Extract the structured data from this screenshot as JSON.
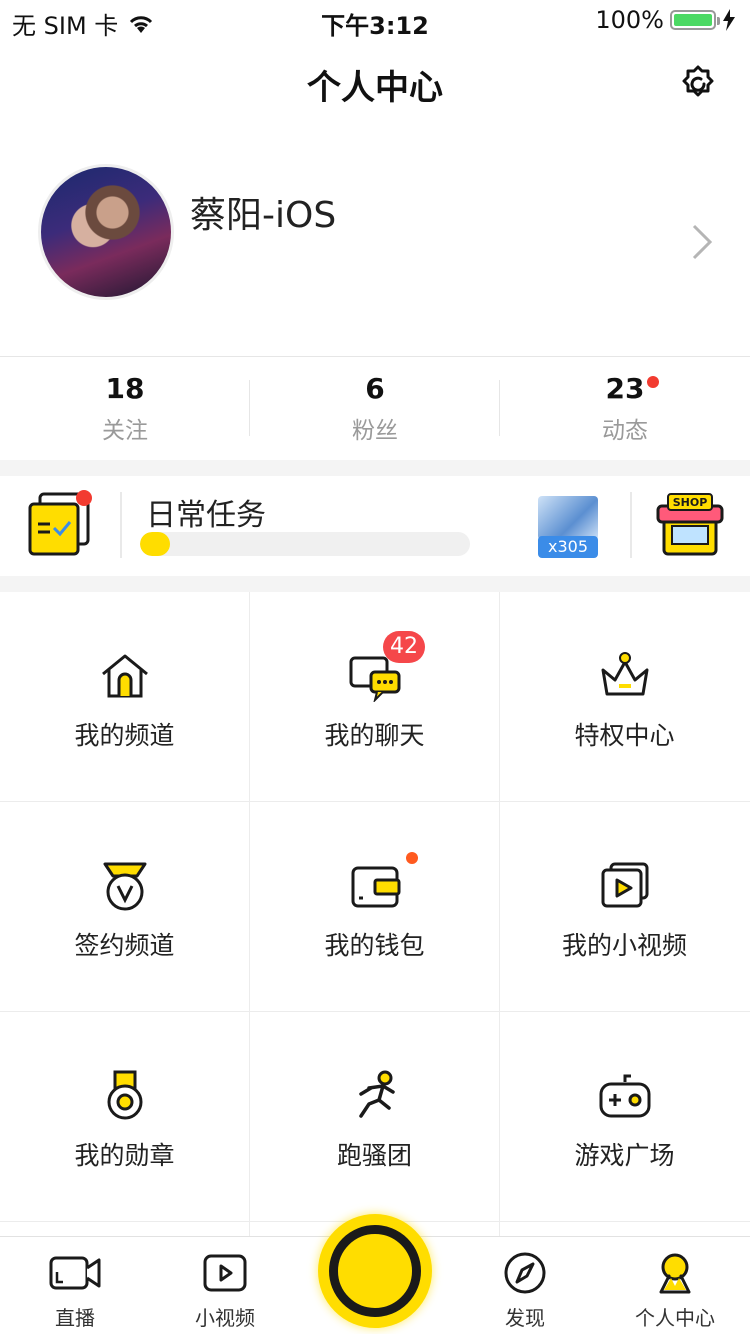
{
  "status_bar": {
    "carrier": "无 SIM 卡",
    "time": "下午3:12",
    "battery": "100%"
  },
  "nav": {
    "title": "个人中心",
    "settings_icon": "settings-gear-icon"
  },
  "profile": {
    "username": "蔡阳-iOS"
  },
  "stats": [
    {
      "value": "18",
      "label": "关注"
    },
    {
      "value": "6",
      "label": "粉丝"
    },
    {
      "value": "23",
      "label": "动态",
      "has_dot": true
    }
  ],
  "daily_task": {
    "title": "日常任务",
    "progress": 0.09,
    "gift_count": "x305"
  },
  "grid": [
    {
      "label": "我的频道",
      "icon": "house-icon"
    },
    {
      "label": "我的聊天",
      "icon": "chat-icon",
      "badge": "42"
    },
    {
      "label": "特权中心",
      "icon": "crown-icon"
    },
    {
      "label": "签约频道",
      "icon": "signed-medal-icon"
    },
    {
      "label": "我的钱包",
      "icon": "wallet-icon",
      "has_dot": true
    },
    {
      "label": "我的小视频",
      "icon": "video-stack-icon"
    },
    {
      "label": "我的勋章",
      "icon": "medal-icon"
    },
    {
      "label": "跑骚团",
      "icon": "runner-icon"
    },
    {
      "label": "游戏广场",
      "icon": "gamepad-icon"
    }
  ],
  "tabs": [
    {
      "label": "直播",
      "icon": "camera-icon"
    },
    {
      "label": "小视频",
      "icon": "play-icon"
    },
    {
      "label": "发现",
      "icon": "compass-icon"
    },
    {
      "label": "个人中心",
      "icon": "person-icon",
      "active": true
    }
  ],
  "colors": {
    "accent": "#ffdd00",
    "badge": "#f5474a",
    "dot": "#f23b30",
    "gift_badge": "#3b8ce8"
  }
}
